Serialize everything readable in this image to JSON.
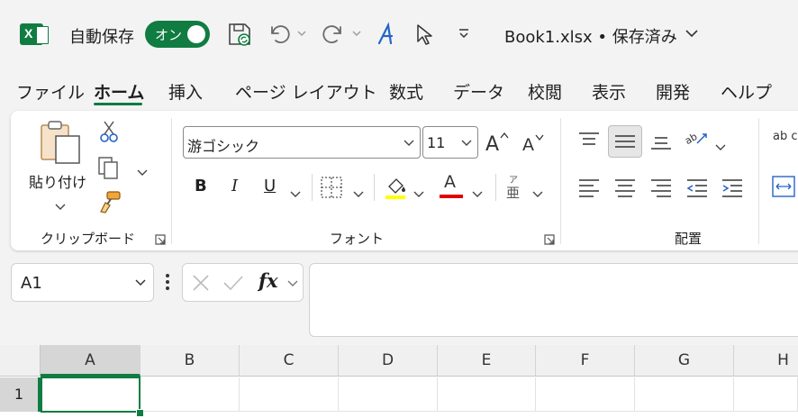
{
  "titlebar": {
    "app_logo_letter": "X",
    "autosave_label": "自動保存",
    "autosave_toggle": "オン",
    "book_title": "Book1.xlsx • 保存済み"
  },
  "tabs": [
    {
      "label": "ファイル"
    },
    {
      "label": "ホーム"
    },
    {
      "label": "挿入"
    },
    {
      "label": "ページ レイアウト"
    },
    {
      "label": "数式"
    },
    {
      "label": "データ"
    },
    {
      "label": "校閲"
    },
    {
      "label": "表示"
    },
    {
      "label": "開発"
    },
    {
      "label": "ヘルプ"
    }
  ],
  "ribbon": {
    "clipboard": {
      "paste_label": "貼り付け",
      "group_label": "クリップボード"
    },
    "font": {
      "font_name": "游ゴシック",
      "font_size": "11",
      "bold": "B",
      "italic": "I",
      "underline": "U",
      "font_color_letter": "A",
      "phonetic_top": "ア",
      "phonetic_bottom": "亜",
      "group_label": "フォント",
      "highlight_color": "#ffff00",
      "font_color": "#e00000"
    },
    "alignment": {
      "group_label": "配置",
      "wrap_text": "ab c"
    }
  },
  "formula_bar": {
    "name_box": "A1",
    "fx_label": "fx",
    "formula_value": ""
  },
  "grid": {
    "columns": [
      "A",
      "B",
      "C",
      "D",
      "E",
      "F",
      "G",
      "H"
    ],
    "rows": [
      "1"
    ],
    "active_cell": "A1"
  },
  "colors": {
    "accent": "#107c41"
  }
}
